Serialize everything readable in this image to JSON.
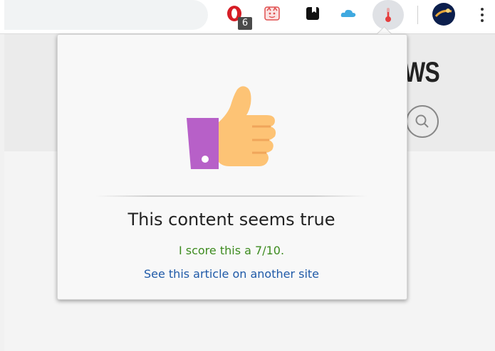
{
  "toolbar": {
    "extensions": [
      {
        "name": "opera-icon",
        "badge": "6"
      },
      {
        "name": "cat-icon"
      },
      {
        "name": "bookmark-icon"
      },
      {
        "name": "cloud-icon"
      },
      {
        "name": "thermometer-icon",
        "active": true
      },
      {
        "name": "profile-avatar"
      }
    ],
    "menu_icon": "more-vert-icon"
  },
  "page": {
    "title_fragment": "WS"
  },
  "popup": {
    "icon": "thumbs-up-icon",
    "verdict": "This content seems true",
    "score_text": "I score this a 7/10.",
    "link_text": "See this article on another site",
    "colors": {
      "score": "#3d8b1f",
      "link": "#1f5aa8",
      "cuff": "#b760c8",
      "hand": "#fdc375"
    }
  }
}
